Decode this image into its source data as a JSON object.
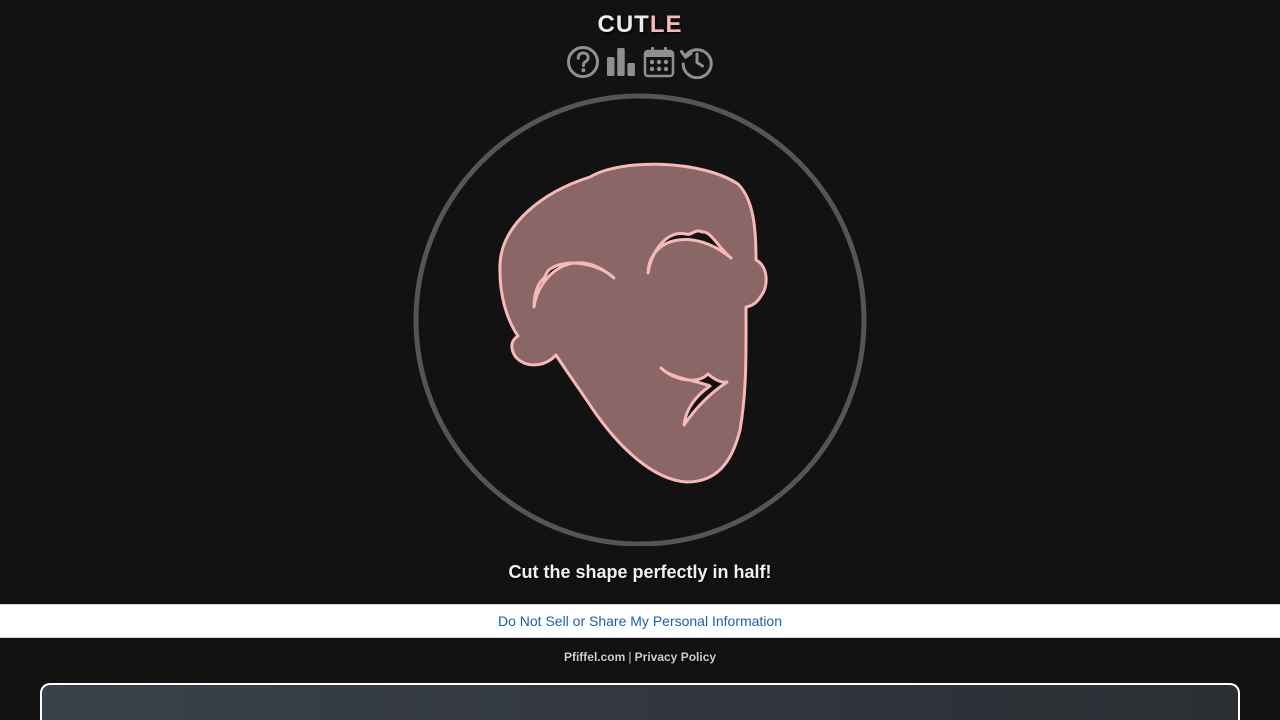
{
  "header": {
    "title_part1": "CUT",
    "title_part2": "LE"
  },
  "toolbar": {
    "icons": [
      "help-icon",
      "stats-icon",
      "calendar-icon",
      "history-icon"
    ]
  },
  "game": {
    "instruction": "Cut the shape perfectly in half!"
  },
  "privacy": {
    "link_label": "Do Not Sell or Share My Personal Information"
  },
  "footer": {
    "site_link": "Pfiffel.com",
    "separator": "|",
    "policy_link": "Privacy Policy"
  },
  "colors": {
    "background": "#121212",
    "shape_fill": "#8a6666",
    "shape_stroke": "#f7b8b8",
    "ring": "#555555",
    "icon": "#8f8f8f",
    "link": "#1a5fb4"
  }
}
